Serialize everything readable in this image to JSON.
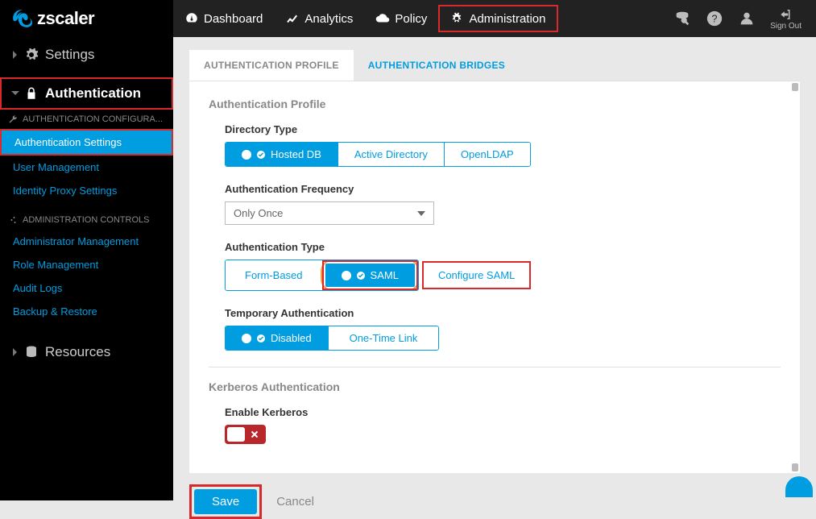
{
  "brand": "zscaler",
  "nav": {
    "dashboard": "Dashboard",
    "analytics": "Analytics",
    "policy": "Policy",
    "administration": "Administration"
  },
  "header_right": {
    "signout": "Sign Out"
  },
  "sidebar": {
    "settings": "Settings",
    "authentication": "Authentication",
    "auth_config_head": "AUTHENTICATION CONFIGURA...",
    "links": {
      "auth_settings": "Authentication Settings",
      "user_mgmt": "User Management",
      "identity_proxy": "Identity Proxy Settings"
    },
    "admin_controls_head": "ADMINISTRATION CONTROLS",
    "admin_links": {
      "admin_mgmt": "Administrator Management",
      "role_mgmt": "Role Management",
      "audit_logs": "Audit Logs",
      "backup_restore": "Backup & Restore"
    },
    "resources": "Resources"
  },
  "tabs": {
    "profile": "AUTHENTICATION PROFILE",
    "bridges": "AUTHENTICATION BRIDGES"
  },
  "panel": {
    "section_profile": "Authentication Profile",
    "directory_type": {
      "label": "Directory Type",
      "options": [
        "Hosted DB",
        "Active Directory",
        "OpenLDAP"
      ],
      "selected": "Hosted DB"
    },
    "auth_frequency": {
      "label": "Authentication Frequency",
      "value": "Only Once"
    },
    "auth_type": {
      "label": "Authentication Type",
      "options": [
        "Form-Based",
        "SAML"
      ],
      "selected": "SAML",
      "configure_link": "Configure SAML"
    },
    "temp_auth": {
      "label": "Temporary Authentication",
      "options": [
        "Disabled",
        "One-Time Link"
      ],
      "selected": "Disabled"
    },
    "section_kerberos": "Kerberos Authentication",
    "enable_kerberos": {
      "label": "Enable Kerberos",
      "value": false
    }
  },
  "actions": {
    "save": "Save",
    "cancel": "Cancel"
  }
}
